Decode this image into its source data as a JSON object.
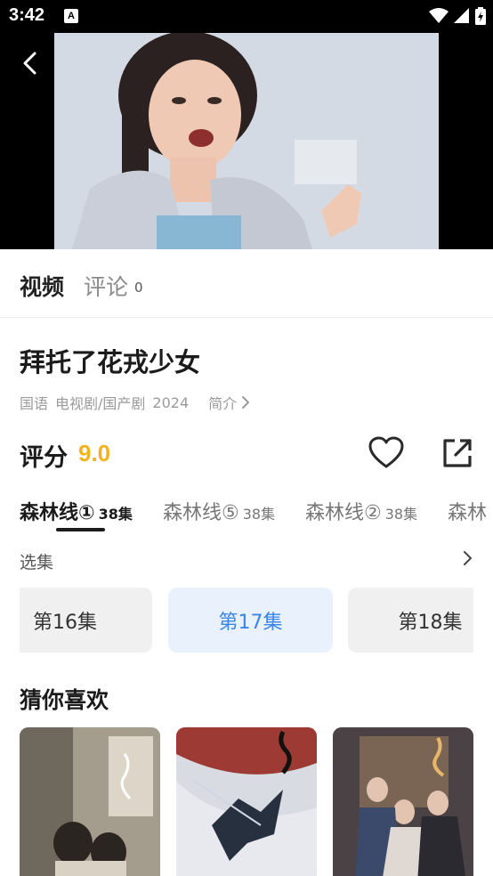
{
  "status_bar": {
    "time": "3:42",
    "notif_icon": "A"
  },
  "icons": {
    "back": "back-arrow-icon",
    "heart": "heart-icon",
    "share": "share-icon",
    "chevron": "chevron-right-icon"
  },
  "tabs": {
    "video": "视频",
    "comment": "评论",
    "comment_count": "0"
  },
  "show": {
    "title": "拜托了花戎少女",
    "language": "国语",
    "genre": "电视剧/国产剧",
    "year": "2024",
    "intro": "简介"
  },
  "rating": {
    "label": "评分",
    "value": "9.0"
  },
  "lines": [
    {
      "name": "森林线①",
      "episodes": "38集"
    },
    {
      "name": "森林线⑤",
      "episodes": "38集"
    },
    {
      "name": "森林线②",
      "episodes": "38集"
    },
    {
      "name": "森林",
      "episodes": ""
    }
  ],
  "select": {
    "label": "选集"
  },
  "episodes": [
    "第16集",
    "第17集",
    "第18集"
  ],
  "recommend": {
    "title": "猜你喜欢"
  },
  "colors": {
    "accent_blue": "#3a86e6",
    "rating_gold": "#f1b421"
  }
}
